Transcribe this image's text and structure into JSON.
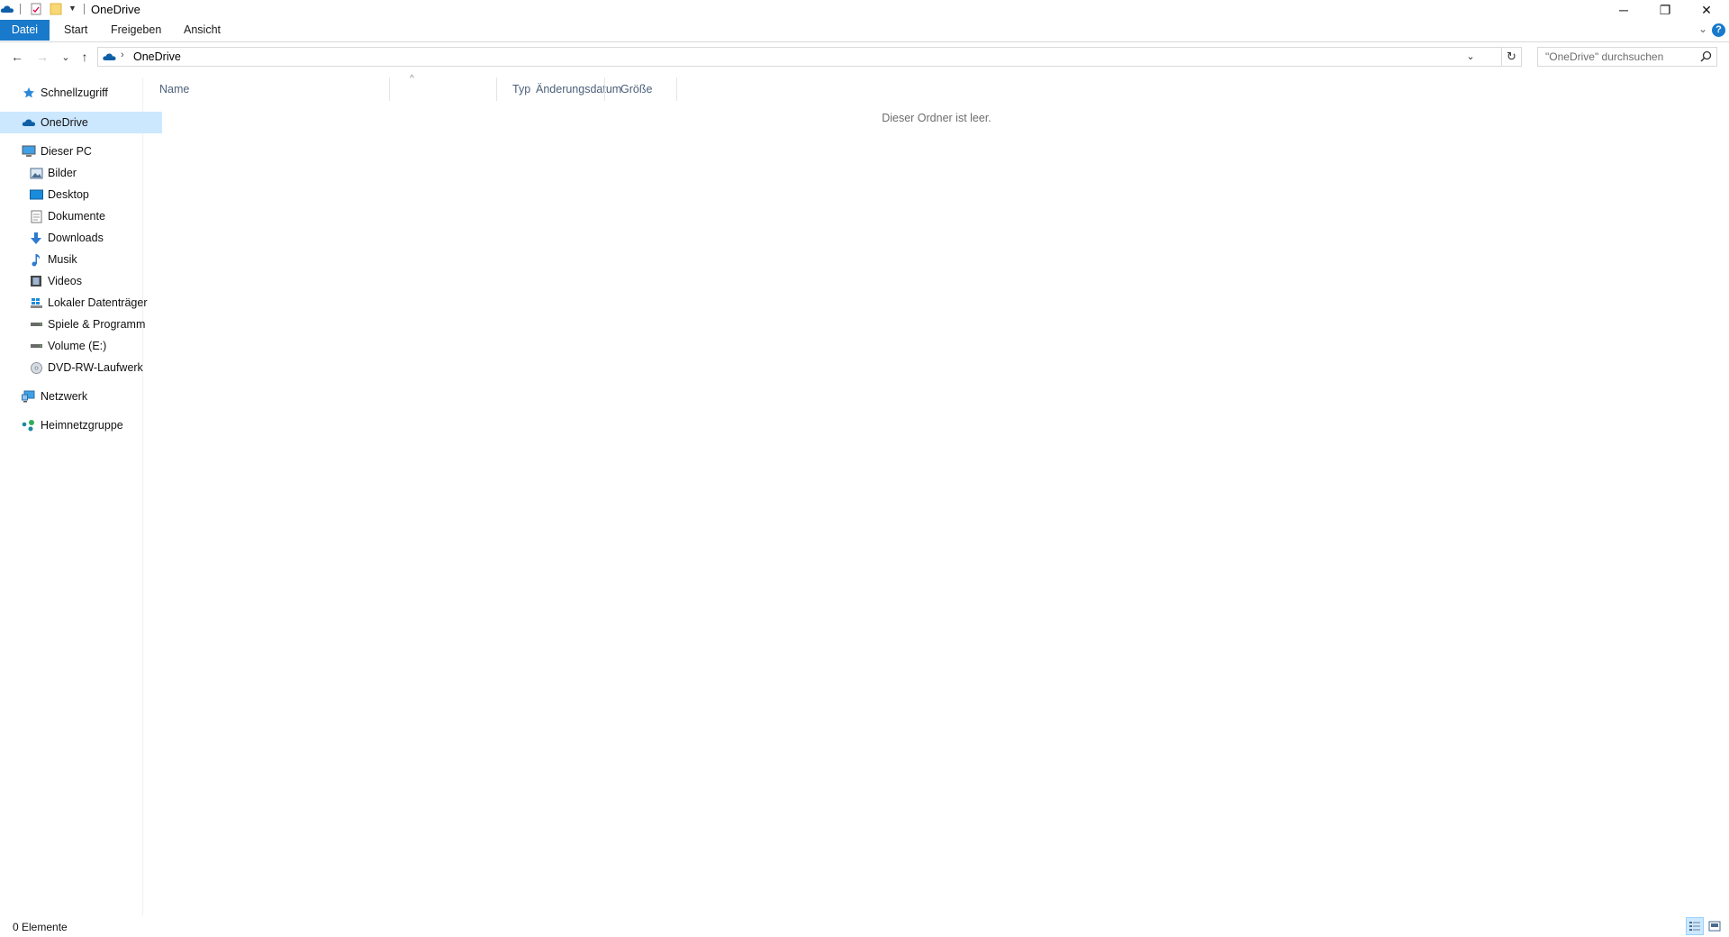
{
  "window": {
    "title": "OneDrive",
    "controls": {
      "minimize": "─",
      "restore": "❐",
      "close": "✕"
    }
  },
  "ribbon": {
    "tabs": [
      {
        "label": "Datei"
      },
      {
        "label": "Start"
      },
      {
        "label": "Freigeben"
      },
      {
        "label": "Ansicht"
      }
    ],
    "help_label": "?"
  },
  "navigation": {
    "back_glyph": "←",
    "forward_glyph": "→",
    "recent_glyph": "⌄",
    "up_glyph": "↑",
    "breadcrumb_separator": "›",
    "breadcrumb": "OneDrive",
    "refresh_glyph": "↻",
    "search_placeholder": "\"OneDrive\" durchsuchen"
  },
  "sidebar": {
    "items": [
      {
        "label": "Schnellzugriff",
        "icon": "star-icon",
        "level": 0
      },
      {
        "label": "OneDrive",
        "icon": "onedrive-cloud-icon",
        "level": 0,
        "selected": true
      },
      {
        "label": "Dieser PC",
        "icon": "computer-icon",
        "level": 0
      },
      {
        "label": "Bilder",
        "icon": "pictures-icon",
        "level": 1
      },
      {
        "label": "Desktop",
        "icon": "desktop-icon",
        "level": 1
      },
      {
        "label": "Dokumente",
        "icon": "documents-icon",
        "level": 1
      },
      {
        "label": "Downloads",
        "icon": "downloads-icon",
        "level": 1
      },
      {
        "label": "Musik",
        "icon": "music-icon",
        "level": 1
      },
      {
        "label": "Videos",
        "icon": "videos-icon",
        "level": 1
      },
      {
        "label": "Lokaler Datenträger",
        "icon": "windows-drive-icon",
        "level": 1
      },
      {
        "label": "Spiele & Programm",
        "icon": "drive-icon",
        "level": 1
      },
      {
        "label": "Volume (E:)",
        "icon": "drive-icon",
        "level": 1
      },
      {
        "label": "DVD-RW-Laufwerk",
        "icon": "dvd-icon",
        "level": 1
      },
      {
        "label": "Netzwerk",
        "icon": "network-icon",
        "level": 0
      },
      {
        "label": "Heimnetzgruppe",
        "icon": "homegroup-icon",
        "level": 0
      }
    ]
  },
  "content": {
    "columns": [
      {
        "label": "Name"
      },
      {
        "label": "Änderungsdatum"
      },
      {
        "label": "Typ"
      },
      {
        "label": "Größe"
      }
    ],
    "sort_indicator": "^",
    "empty_message": "Dieser Ordner ist leer."
  },
  "status": {
    "item_count": "0 Elemente"
  },
  "colors": {
    "accent": "#1979ca",
    "selection": "#cce8ff",
    "onedrive_blue": "#0f5fa8"
  }
}
